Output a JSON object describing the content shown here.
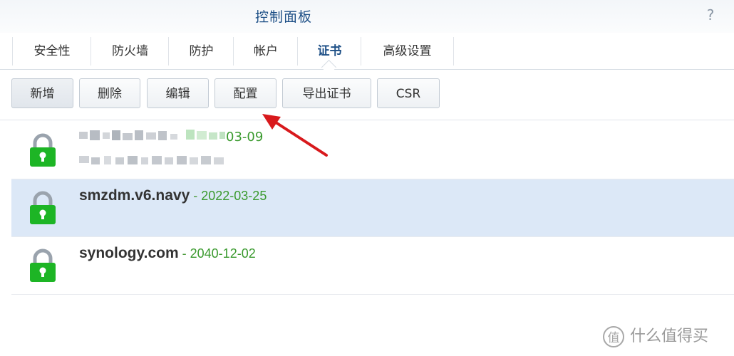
{
  "window": {
    "title": "控制面板",
    "help_icon": "?"
  },
  "tabs": [
    {
      "label": "安全性"
    },
    {
      "label": "防火墙"
    },
    {
      "label": "防护"
    },
    {
      "label": "帐户"
    },
    {
      "label": "证书",
      "active": true
    },
    {
      "label": "高级设置"
    }
  ],
  "toolbar": {
    "add_label": "新增",
    "delete_label": "删除",
    "edit_label": "编辑",
    "configure_label": "配置",
    "export_label": "导出证书",
    "csr_label": "CSR"
  },
  "certificates": [
    {
      "name": "",
      "date": "03-09",
      "obscured": true
    },
    {
      "name": "smzdm.v6.navy",
      "separator": " - ",
      "date": "2022-03-25",
      "selected": true
    },
    {
      "name": "synology.com",
      "separator": " - ",
      "date": "2040-12-02"
    }
  ],
  "watermark": {
    "logo_char": "值",
    "text": "什么值得买"
  },
  "colors": {
    "title": "#1d4f86",
    "date_green": "#3a9a2e",
    "lock_green": "#1db525",
    "selected_row": "#dce8f7",
    "arrow_red": "#d8191c"
  }
}
